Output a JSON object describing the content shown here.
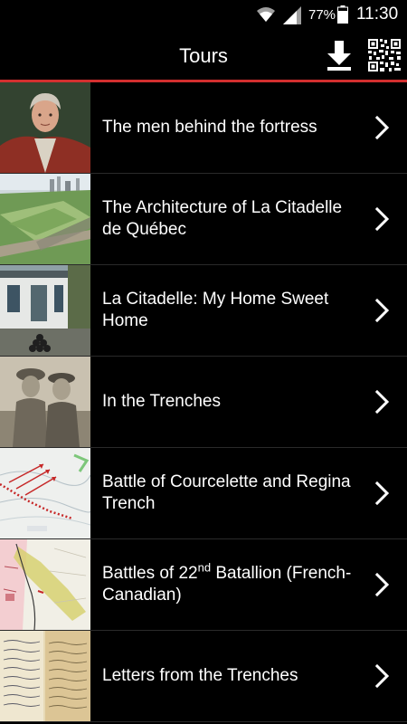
{
  "status_bar": {
    "battery_percent": "77%",
    "time": "11:30",
    "wifi_icon": "wifi-icon",
    "signal_icon": "cell-signal-icon",
    "battery_icon": "battery-icon"
  },
  "header": {
    "title": "Tours",
    "download_icon": "download-icon",
    "qr_icon": "qr-code-icon",
    "accent_color": "#d32f2f"
  },
  "tours": [
    {
      "label": "The men behind the fortress"
    },
    {
      "label": "The Architecture of La Citadelle de Québec"
    },
    {
      "label": "La Citadelle: My Home Sweet Home"
    },
    {
      "label": "In the Trenches"
    },
    {
      "label": "Battle of Courcelette and Regina Trench"
    },
    {
      "label_prefix": "Battles of 22",
      "label_sup": "nd",
      "label_suffix": " Batallion (French-Canadian)"
    },
    {
      "label": "Letters from the Trenches"
    }
  ]
}
